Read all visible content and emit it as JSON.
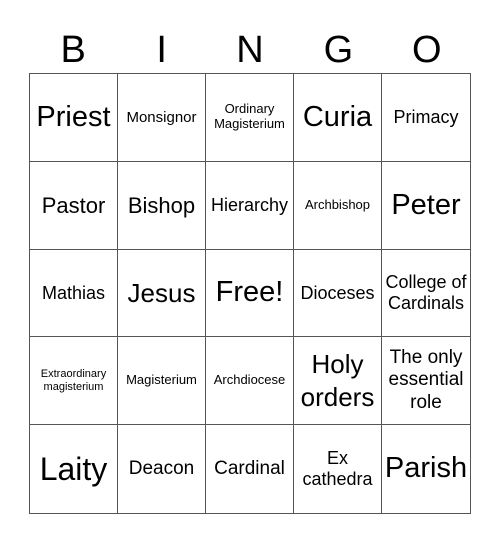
{
  "header": {
    "letters": [
      "B",
      "I",
      "N",
      "G",
      "O"
    ]
  },
  "cells": [
    "Priest",
    "Monsignor",
    "Ordinary Magisterium",
    "Curia",
    "Primacy",
    "Pastor",
    "Bishop",
    "Hierarchy",
    "Archbishop",
    "Peter",
    "Mathias",
    "Jesus",
    "Free!",
    "Dioceses",
    "College of Cardinals",
    "Extraordinary magisterium",
    "Magisterium",
    "Archdiocese",
    "Holy orders",
    "The only essential role",
    "Laity",
    "Deacon",
    "Cardinal",
    "Ex cathedra",
    "Parish"
  ]
}
